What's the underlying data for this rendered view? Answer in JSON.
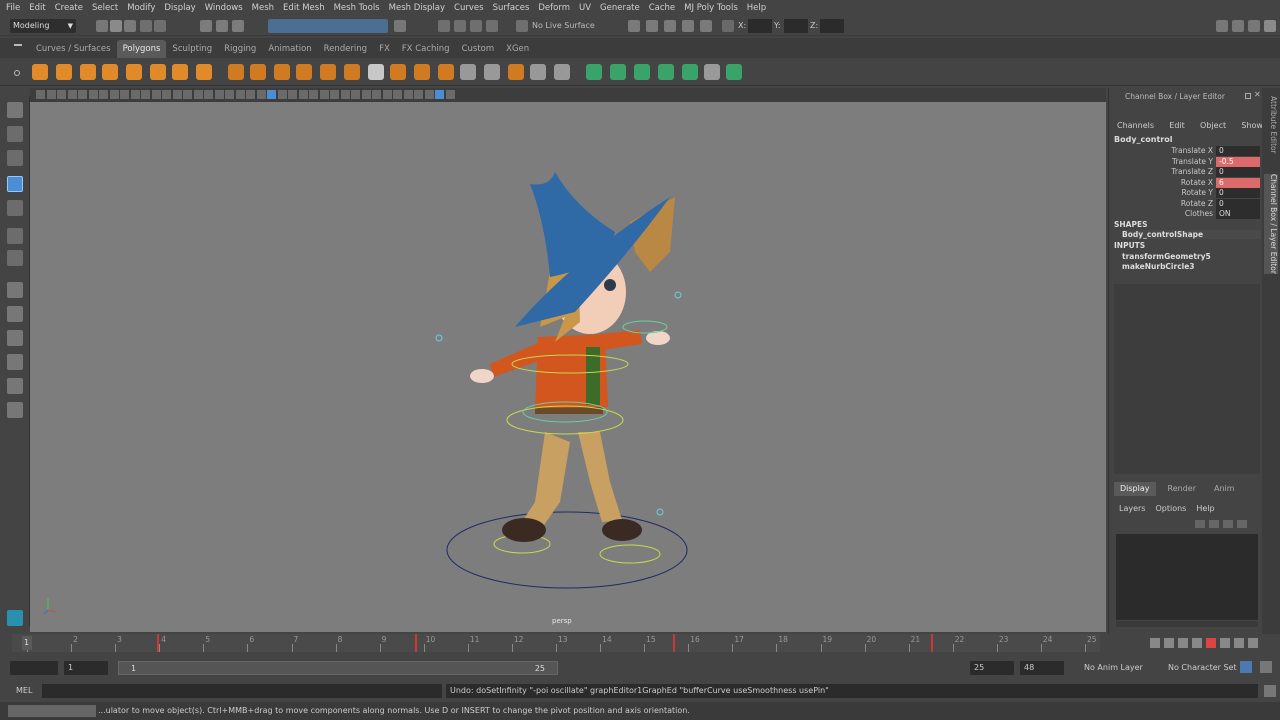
{
  "menu": [
    "File",
    "Edit",
    "Create",
    "Select",
    "Modify",
    "Display",
    "Windows",
    "Mesh",
    "Edit Mesh",
    "Mesh Tools",
    "Mesh Display",
    "Curves",
    "Surfaces",
    "Deform",
    "UV",
    "Generate",
    "Cache",
    "MJ Poly Tools",
    "Help"
  ],
  "status_line": {
    "mode": "Modeling",
    "live_surface": "No Live Surface",
    "x_label": "X:",
    "y_label": "Y:",
    "z_label": "Z:"
  },
  "shelf_tabs": [
    "Curves / Surfaces",
    "Polygons",
    "Sculpting",
    "Rigging",
    "Animation",
    "Rendering",
    "FX",
    "FX Caching",
    "Custom",
    "XGen"
  ],
  "active_shelf_tab": "Polygons",
  "viewport": {
    "camera_label": "persp"
  },
  "channel_box": {
    "title": "Channel Box / Layer Editor",
    "menus": [
      "Channels",
      "Edit",
      "Object",
      "Show"
    ],
    "object_name": "Body_control",
    "channels": [
      {
        "label": "Translate X",
        "value": "0",
        "keyed": false
      },
      {
        "label": "Translate Y",
        "value": "-0.5",
        "keyed": true
      },
      {
        "label": "Translate Z",
        "value": "0",
        "keyed": false
      },
      {
        "label": "Rotate X",
        "value": "6",
        "keyed": true
      },
      {
        "label": "Rotate Y",
        "value": "0",
        "keyed": false
      },
      {
        "label": "Rotate Z",
        "value": "0",
        "keyed": false
      },
      {
        "label": "Clothes",
        "value": "ON",
        "keyed": false
      }
    ],
    "shapes_header": "SHAPES",
    "shape_name": "Body_controlShape",
    "inputs_header": "INPUTS",
    "inputs": [
      "transformGeometry5",
      "makeNurbCircle3"
    ],
    "layer_tabs": [
      "Display",
      "Render",
      "Anim"
    ],
    "layer_menus": [
      "Layers",
      "Options",
      "Help"
    ],
    "side_tabs": [
      "Attribute Editor",
      "Channel Box / Layer Editor"
    ]
  },
  "time_slider": {
    "current_frame": "1",
    "ticks": [
      "1",
      "2",
      "3",
      "4",
      "5",
      "6",
      "7",
      "8",
      "9",
      "10",
      "11",
      "12",
      "13",
      "14",
      "15",
      "16",
      "17",
      "18",
      "19",
      "20",
      "21",
      "22",
      "23",
      "24",
      "25"
    ]
  },
  "range_slider": {
    "start": "1",
    "range_start": "1",
    "range_end": "25",
    "end": "25",
    "anim_end": "48",
    "anim_layer": "No Anim Layer",
    "character_set": "No Character Set"
  },
  "command_line": {
    "language": "MEL",
    "result": "Undo: doSetInfinity \"-poi oscillate\" graphEditor1GraphEd \"bufferCurve useSmoothness usePin\""
  },
  "help_line": "...ulator to move object(s). Ctrl+MMB+drag to move components along normals. Use D or INSERT to change the pivot position and axis orientation."
}
